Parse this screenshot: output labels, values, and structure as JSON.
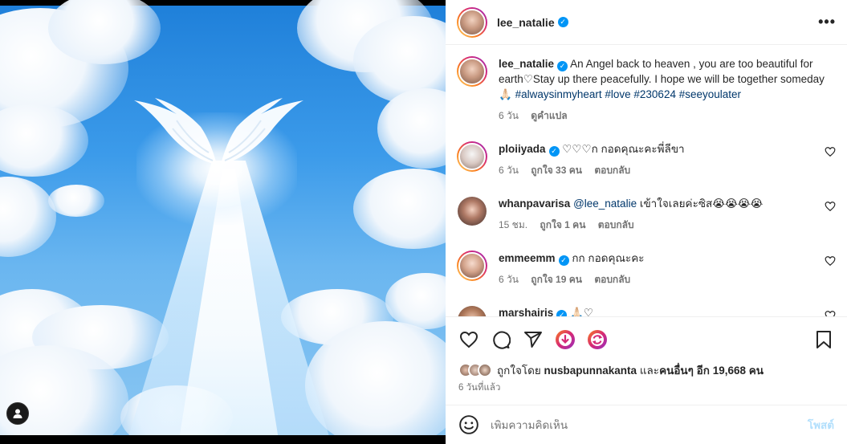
{
  "post": {
    "author": "lee_natalie",
    "caption_text": "An Angel back to heaven , you are too beautiful for earth♡Stay up there peacefully. I hope we will be together someday 🙏🏻",
    "hashtags": "#alwaysinmyheart #love #230624 #seeyoulater",
    "caption_age": "6 วัน",
    "translate_label": "ดูคำแปล"
  },
  "comments": [
    {
      "user": "ploiiyada",
      "verified": true,
      "text": "♡♡♡ก กอดคุณะคะพี่ลีขา",
      "age": "6 วัน",
      "likes": "ถูกใจ 33 คน",
      "reply": "ตอบกลับ"
    },
    {
      "user": "whanpavarisa",
      "verified": false,
      "mention": "@lee_natalie",
      "text": " เข้าใจเลยค่ะซิส😭😭😭😭",
      "age": "15 ชม.",
      "likes": "ถูกใจ 1 คน",
      "reply": "ตอบกลับ"
    },
    {
      "user": "emmeemm",
      "verified": true,
      "text": "กก กอดคุณะคะ",
      "age": "6 วัน",
      "likes": "ถูกใจ 19 คน",
      "reply": "ตอบกลับ"
    },
    {
      "user": "marshairis",
      "verified": true,
      "text": "🙏🏻♡",
      "age": "",
      "likes": "",
      "reply": ""
    }
  ],
  "likes_bar": {
    "prefix": "ถูกใจโดย",
    "first_liker": "nusbapunnakanta",
    "middle": "และ",
    "others": "คนอื่นๆ อีก 19,668 คน"
  },
  "post_time": "6 วันที่แล้ว",
  "add_comment": {
    "placeholder": "เพิ่มความคิดเห็น",
    "post_label": "โพสต์"
  },
  "icons": {
    "like": "heart-icon",
    "comment": "comment-icon",
    "share": "share-icon",
    "save": "bookmark-icon",
    "emoji": "emoji-icon",
    "more": "more-options-icon",
    "verified": "verified-badge-icon",
    "profile_tag": "user-tag-icon"
  },
  "colors": {
    "verified": "#0095f6",
    "link": "#00376b",
    "muted": "#737373",
    "post_button": "#b2dffc"
  }
}
